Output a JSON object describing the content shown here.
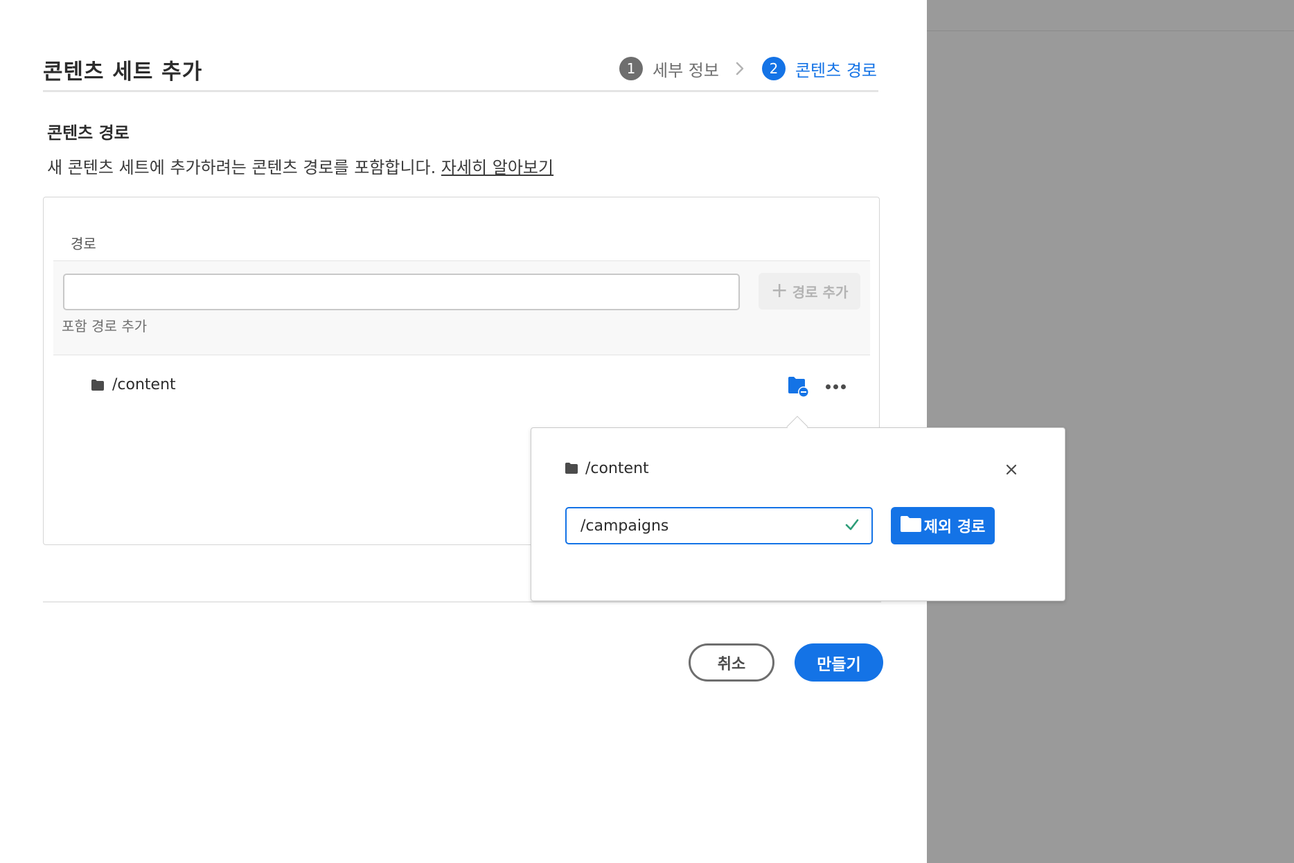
{
  "dialog": {
    "title": "콘텐츠 세트 추가",
    "steps": [
      {
        "number": "1",
        "label": "세부 정보",
        "state": "done"
      },
      {
        "number": "2",
        "label": "콘텐츠 경로",
        "state": "active"
      }
    ]
  },
  "section": {
    "heading": "콘텐츠 경로",
    "description": "새 콘텐츠 세트에 추가하려는 콘텐츠 경로를 포함합니다. ",
    "learn_more": "자세히 알아보기"
  },
  "paths": {
    "column_label": "경로",
    "input_value": "",
    "help_text": "포함 경로 추가",
    "add_button": "경로 추가",
    "rows": [
      {
        "path": "/content"
      }
    ]
  },
  "popover": {
    "path": "/content",
    "exclude_value": "/campaigns",
    "exclude_button": "제외 경로"
  },
  "footer": {
    "cancel": "취소",
    "create": "만들기"
  },
  "colors": {
    "accent": "#1473e6",
    "backdrop": "#9a9a9a",
    "valid": "#2d9d78"
  },
  "icons": [
    "chevron-right-icon",
    "folder-icon",
    "folder-exclude-icon",
    "more-icon",
    "close-icon",
    "checkmark-icon",
    "plus-icon"
  ]
}
